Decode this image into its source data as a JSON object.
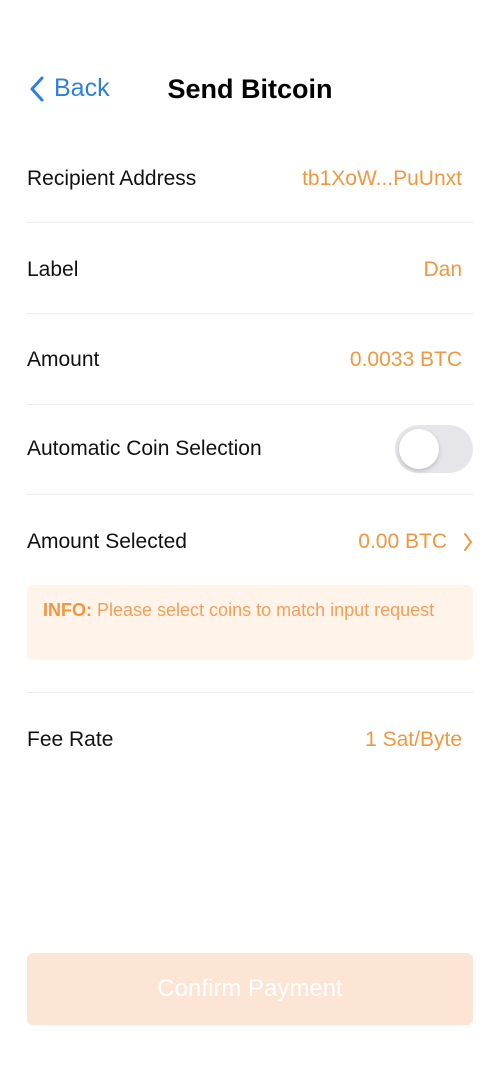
{
  "header": {
    "back_label": "Back",
    "title": "Send Bitcoin"
  },
  "form": {
    "recipient": {
      "label": "Recipient Address",
      "value": "tb1XoW...PuUnxt"
    },
    "label": {
      "label": "Label",
      "value": "Dan"
    },
    "amount": {
      "label": "Amount",
      "value": "0.0033 BTC"
    },
    "auto_coin": {
      "label": "Automatic Coin Selection",
      "enabled": false
    },
    "amount_selected": {
      "label": "Amount Selected",
      "value": "0.00 BTC"
    },
    "info": {
      "tag": "INFO:",
      "text": " Please select coins to match input request"
    },
    "fee_rate": {
      "label": "Fee Rate",
      "value": "1 Sat/Byte"
    }
  },
  "confirm_label": "Confirm Payment",
  "colors": {
    "accent": "#f0973f",
    "link": "#2f7fe0",
    "info_bg": "#fff3ea",
    "button_disabled_bg": "#fde5d6"
  }
}
